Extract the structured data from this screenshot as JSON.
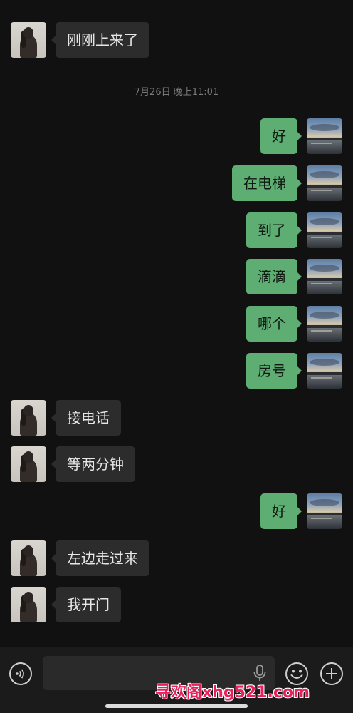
{
  "timestamp": "7月26日 晚上11:01",
  "messages": [
    {
      "side": "left",
      "text": "刚刚上来了"
    },
    {
      "side": "right",
      "text": "好"
    },
    {
      "side": "right",
      "text": "在电梯"
    },
    {
      "side": "right",
      "text": "到了"
    },
    {
      "side": "right",
      "text": "滴滴"
    },
    {
      "side": "right",
      "text": "哪个"
    },
    {
      "side": "right",
      "text": "房号"
    },
    {
      "side": "left",
      "text": "接电话"
    },
    {
      "side": "left",
      "text": "等两分钟"
    },
    {
      "side": "right",
      "text": "好"
    },
    {
      "side": "left",
      "text": "左边走过来"
    },
    {
      "side": "left",
      "text": "我开门"
    }
  ],
  "input": {
    "value": "",
    "placeholder": ""
  },
  "icons": {
    "voice": "voice-input-icon",
    "mic": "microphone-icon",
    "emoji": "emoji-icon",
    "plus": "plus-icon"
  },
  "watermark": "寻欢阁xhg521.com",
  "colors": {
    "background": "#111111",
    "incoming_bubble": "#2c2c2c",
    "outgoing_bubble": "#5ead72",
    "watermark": "#e8215c"
  }
}
